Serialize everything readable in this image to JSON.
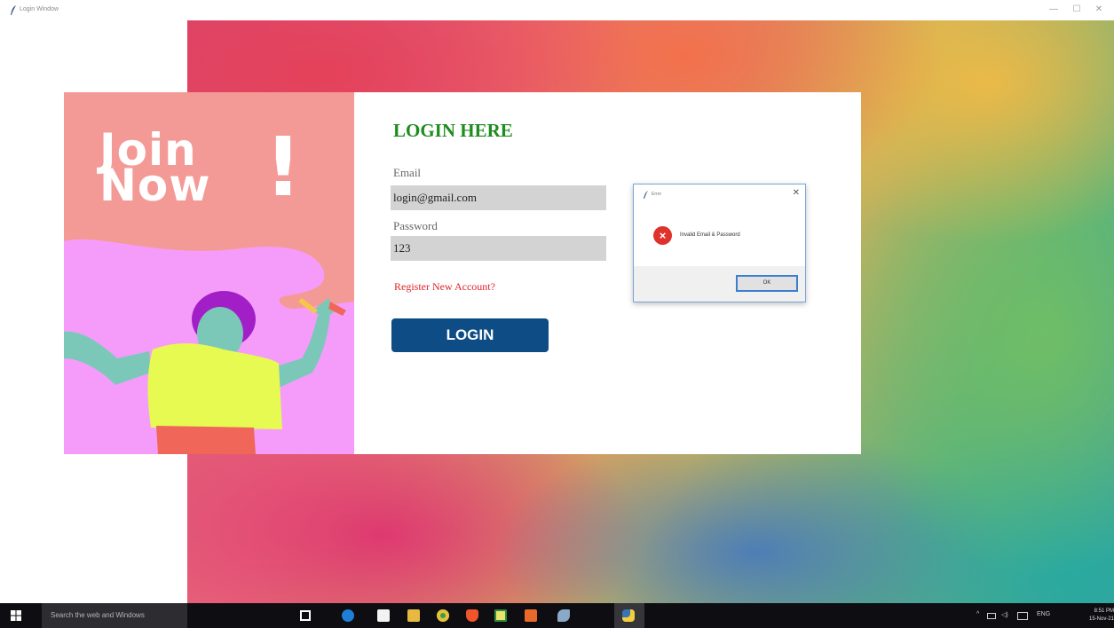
{
  "window": {
    "title": "Login Window",
    "controls": {
      "minimize": "—",
      "maximize": "☐",
      "close": "✕"
    }
  },
  "art": {
    "join_word": "Join",
    "now_word": "Now",
    "exclamation": "!",
    "colors": {
      "top": "#f49a96",
      "bottom": "#f59cfb",
      "hair": "#a21fc7",
      "skin": "#7cc8b8",
      "shirt": "#e6fa52",
      "pants": "#f0675a"
    }
  },
  "form": {
    "heading": "LOGIN HERE",
    "email_label": "Email",
    "email_value": "login@gmail.com",
    "password_label": "Password",
    "password_value": "123",
    "register_link": "Register New Account?",
    "login_button": "LOGIN",
    "colors": {
      "heading": "#1e8c1e",
      "link": "#e0232c",
      "button": "#0d4c84",
      "field": "#d3d3d3"
    }
  },
  "messagebox": {
    "title": "Error",
    "icon": "error-icon",
    "message": "Invalid Email & Password",
    "ok_button": "OK",
    "close": "✕"
  },
  "taskbar": {
    "search_placeholder": "Search the web and Windows",
    "icons": [
      "task-view-icon",
      "edge-icon",
      "store-icon",
      "file-explorer-icon",
      "chrome-icon",
      "brave-icon",
      "notepad-icon",
      "office-icon",
      "feather-app-icon",
      "python-icon"
    ],
    "tray": {
      "lang": "ENG"
    },
    "clock_time": "8:51 PM",
    "clock_date": "15-Nov-21"
  }
}
